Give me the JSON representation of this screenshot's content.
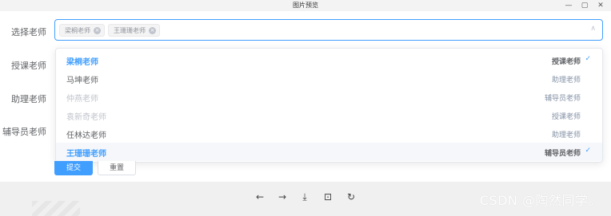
{
  "window": {
    "title": "图片预览",
    "controls": [
      "—",
      "▢",
      "✕"
    ]
  },
  "form": {
    "labels": [
      "选择老师",
      "授课老师",
      "助理老师",
      "辅导员老师"
    ],
    "select": {
      "tags": [
        {
          "label": "梁桐老师"
        },
        {
          "label": "王珊珊老师"
        }
      ],
      "arrow": "∧"
    },
    "options": [
      {
        "name": "梁桐老师",
        "role": "授课老师",
        "state": "selected",
        "check": "✓"
      },
      {
        "name": "马坤老师",
        "role": "助理老师",
        "state": "normal",
        "check": ""
      },
      {
        "name": "仲燕老师",
        "role": "辅导员老师",
        "state": "disabled",
        "check": ""
      },
      {
        "name": "袁新奇老师",
        "role": "授课老师",
        "state": "disabled",
        "check": ""
      },
      {
        "name": "任林达老师",
        "role": "助理老师",
        "state": "normal",
        "check": ""
      },
      {
        "name": "王珊珊老师",
        "role": "辅导员老师",
        "state": "selected-hover",
        "check": "✓"
      }
    ],
    "buttons": {
      "submit": "提交",
      "reset": "重置"
    }
  },
  "toolbar": {
    "icons": [
      "←",
      "→",
      "⤓",
      "⊡",
      "↻"
    ]
  },
  "watermark": "CSDN @陶然同学。"
}
